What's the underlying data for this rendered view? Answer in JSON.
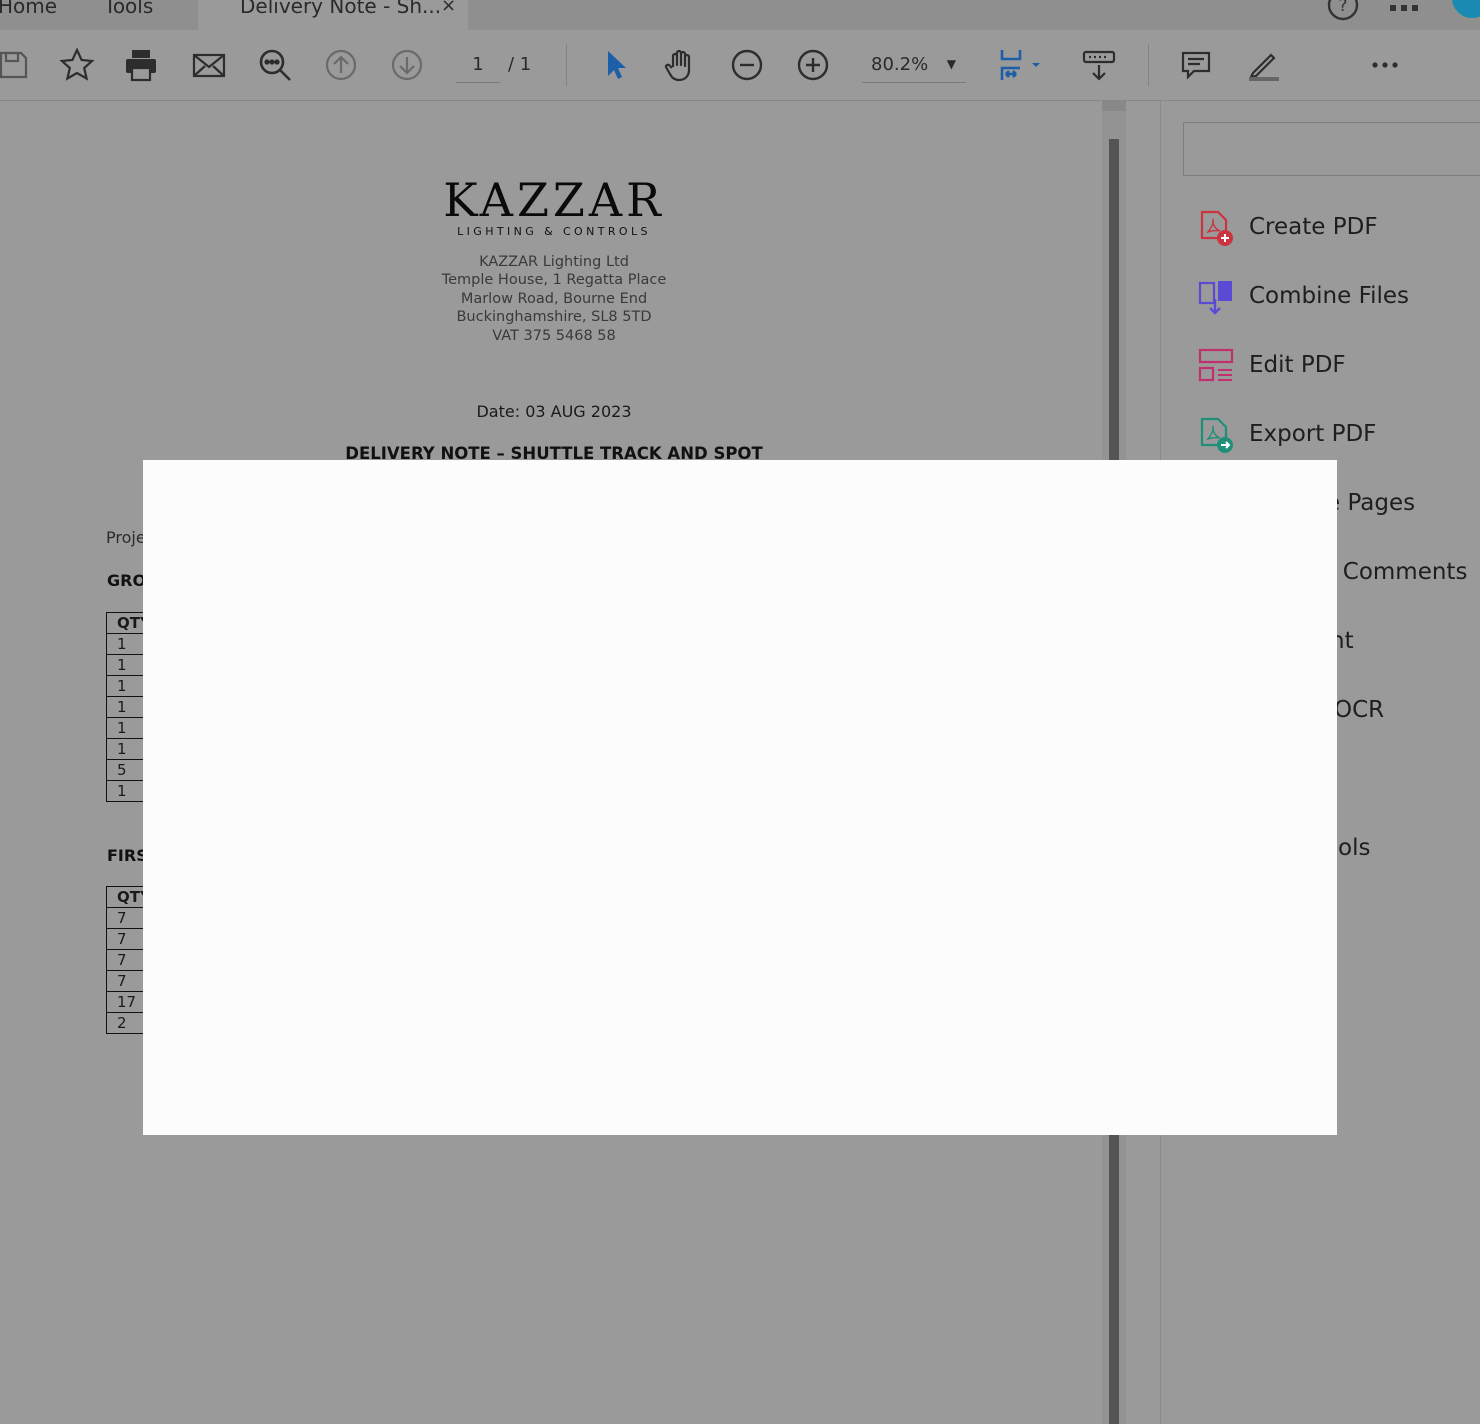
{
  "tabs": {
    "home": "Home",
    "tools": "Tools",
    "document": "Delivery Note - Sh...",
    "close": "×"
  },
  "toolbar": {
    "page_current": "1",
    "page_total": "/ 1",
    "zoom": "80.2%",
    "zoom_caret": "▼"
  },
  "document": {
    "logo": "KAZZAR",
    "logo_sub": "LIGHTING & CONTROLS",
    "address": [
      "KAZZAR Lighting Ltd",
      "Temple House, 1 Regatta Place",
      "Marlow Road, Bourne End",
      "Buckinghamshire, SL8 5TD",
      "VAT 375 5468 58"
    ],
    "date": "Date: 03 AUG 2023",
    "heading": "DELIVERY NOTE – SHUTTLE TRACK AND SPOT",
    "project_label": "Proje",
    "section1": "GRO",
    "section2": "FIRST",
    "table_header": "QTY",
    "table1_qty": [
      "1",
      "1",
      "1",
      "1",
      "1",
      "1",
      "5",
      "1"
    ],
    "table2_qty": [
      "7",
      "7",
      "7",
      "7",
      "17",
      "2"
    ]
  },
  "panel": {
    "items": [
      {
        "label": "Create PDF",
        "color": "#c9343f"
      },
      {
        "label": "Combine Files",
        "color": "#5b4bd4"
      },
      {
        "label": "Edit PDF",
        "color": "#c0306e"
      },
      {
        "label": "Export PDF",
        "color": "#1f8f7a"
      },
      {
        "label": "e Pages"
      },
      {
        "label": "r Comments"
      },
      {
        "label": "nt"
      },
      {
        "label": "OCR"
      },
      {
        "label": "ols"
      }
    ]
  },
  "colors": {
    "accent": "#1473e6",
    "dimmed_background": "#9a9a9a",
    "modal": "#fcfcfc"
  }
}
